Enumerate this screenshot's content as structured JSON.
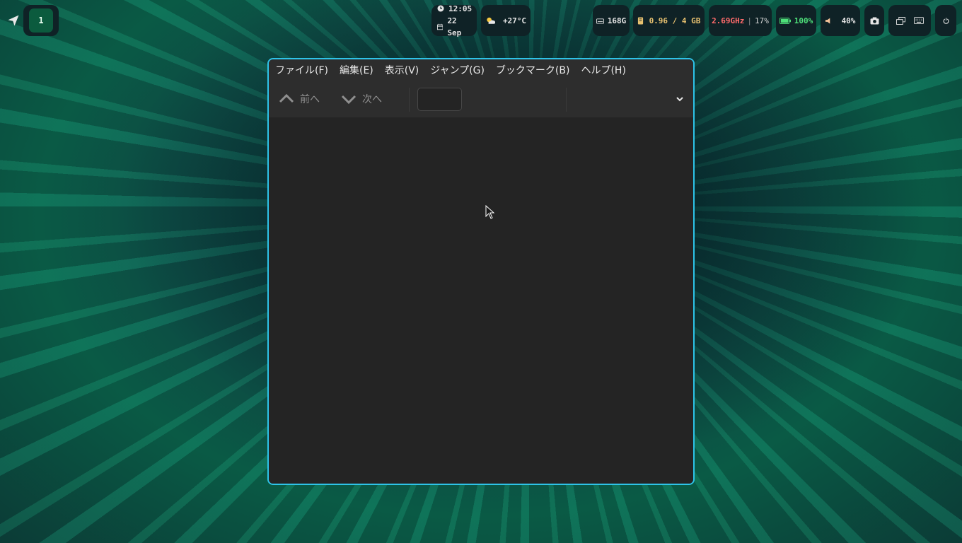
{
  "topbar": {
    "workspace": "1",
    "clock": {
      "time": "12:05",
      "date": "22 Sep"
    },
    "weather": "+27°C",
    "disk": "168G",
    "memory": "0.96 / 4 GB",
    "cpu": {
      "freq": "2.69GHz",
      "sep": "|",
      "usage": "17%"
    },
    "battery": "100%",
    "volume": "40%"
  },
  "colors": {
    "accent_border": "#2ec3e8",
    "memory_text": "#e8c170",
    "cpu_text": "#ff6b6b",
    "battery_text": "#4ee07a",
    "volume_text": "#f5c39a"
  },
  "app": {
    "menu": [
      "ファイル(F)",
      "編集(E)",
      "表示(V)",
      "ジャンプ(G)",
      "ブックマーク(B)",
      "ヘルプ(H)"
    ],
    "toolbar": {
      "prev_label": "前へ",
      "next_label": "次へ",
      "page_value": ""
    }
  }
}
